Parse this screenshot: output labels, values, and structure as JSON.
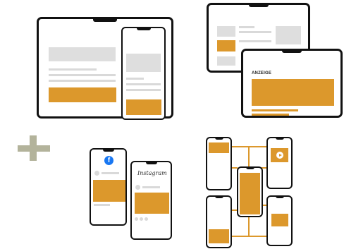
{
  "ad_label": "ANZEIGE",
  "instagram_wordmark": "Instagram",
  "facebook_glyph": "f",
  "colors": {
    "accent": "#dc982c",
    "frame": "#111111",
    "placeholder": "#dedede",
    "plus": "#b3b39b",
    "facebook": "#1877f2"
  },
  "icons": [
    "facebook-icon",
    "play-icon",
    "plus-icon"
  ]
}
